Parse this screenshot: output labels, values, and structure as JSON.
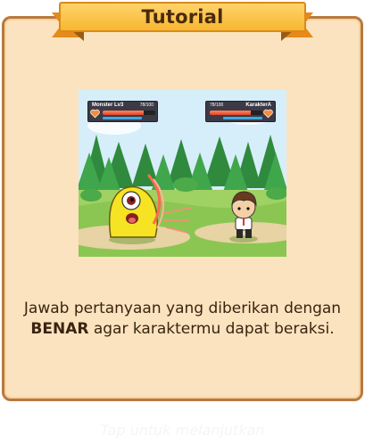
{
  "tutorial": {
    "title": "Tutorial",
    "instruction_part1": "Jawab pertanyaan yang diberikan dengan ",
    "instruction_bold": "BENAR",
    "instruction_part2": " agar karaktermu dapat beraksi.",
    "tap_hint": "Tap untuk melanjutkan"
  },
  "game_scene": {
    "enemy": {
      "name": "Monster Lv3",
      "hp_text": "78/100",
      "hp_fraction": 0.78
    },
    "player": {
      "name": "KarakterA",
      "hp_text": "78/100",
      "hp_fraction": 0.78
    }
  },
  "colors": {
    "card_background": "#fbe3bf",
    "card_border": "#b87a3e",
    "ribbon": "#f7b731",
    "hp_bar": "#e2402a",
    "text": "#3a2410"
  }
}
